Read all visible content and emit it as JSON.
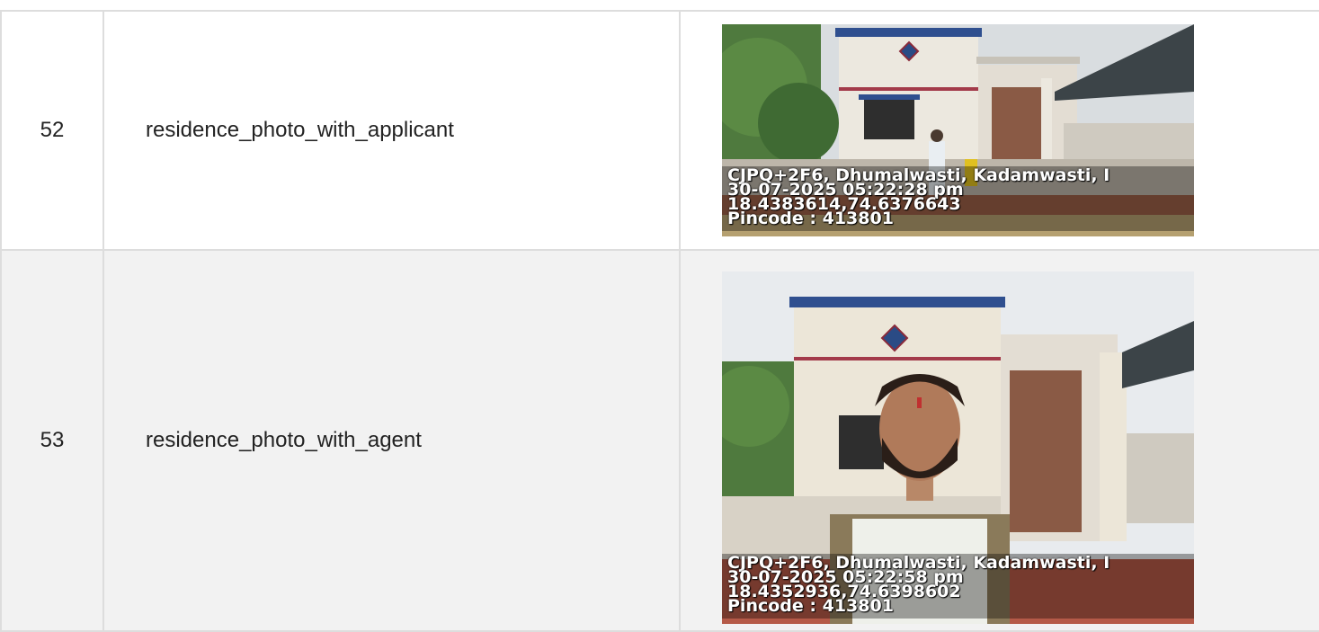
{
  "rows": [
    {
      "number": "52",
      "field": "residence_photo_with_applicant",
      "photo": {
        "icon": "house-photo",
        "stamp": [
          "CJPQ+2F6, Dhumalwasti, Kadamwasti, I",
          "30-07-2025 05:22:28 pm",
          "18.4383614,74.6376643",
          "Pincode : 413801"
        ]
      }
    },
    {
      "number": "53",
      "field": "residence_photo_with_agent",
      "photo": {
        "icon": "selfie-house-photo",
        "stamp": [
          "CJPQ+2F6, Dhumalwasti, Kadamwasti, I",
          "30-07-2025 05:22:58 pm",
          "18.4352936,74.6398602",
          "Pincode : 413801"
        ]
      }
    }
  ],
  "colors": {
    "border": "#dddddd",
    "alt_row": "#f2f2f2",
    "text": "#222222"
  }
}
